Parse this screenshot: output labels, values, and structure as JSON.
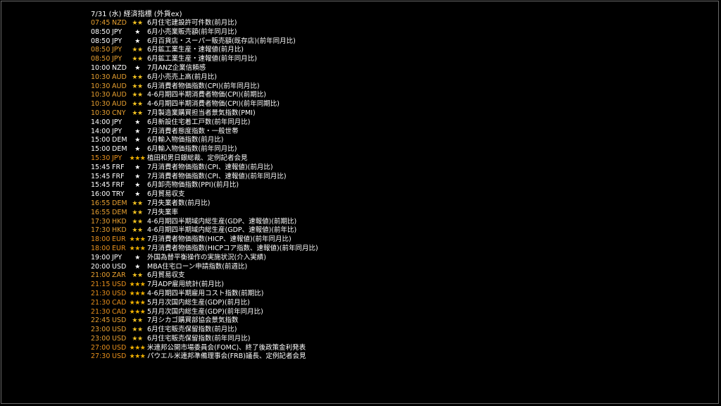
{
  "title": "7/31 (水) 経済指標 (外貨ex)",
  "colors": {
    "background": "#000000",
    "text": "#ffffff",
    "highlight_time": "#e8a030",
    "star": "#f0c020"
  },
  "events": [
    {
      "time": "07:45",
      "currency": "NZD",
      "stars": "★★",
      "name": "6月住宅建設許可件数(前月比)",
      "level": "hi"
    },
    {
      "time": "08:50",
      "currency": "JPY",
      "stars": "★",
      "name": "6月小売業販売額(前年同月比)",
      "level": "normal"
    },
    {
      "time": "08:50",
      "currency": "JPY",
      "stars": "★",
      "name": "6月百貨店・スーパー販売額(既存店)(前年同月比)",
      "level": "normal"
    },
    {
      "time": "08:50",
      "currency": "JPY",
      "stars": "★★",
      "name": "6月鉱工業生産・速報値(前月比)",
      "level": "hi"
    },
    {
      "time": "08:50",
      "currency": "JPY",
      "stars": "★★",
      "name": "6月鉱工業生産・速報値(前年同月比)",
      "level": "hi"
    },
    {
      "time": "10:00",
      "currency": "NZD",
      "stars": "★",
      "name": "7月ANZ企業信頼感",
      "level": "normal"
    },
    {
      "time": "10:30",
      "currency": "AUD",
      "stars": "★★",
      "name": "6月小売売上高(前月比)",
      "level": "hi"
    },
    {
      "time": "10:30",
      "currency": "AUD",
      "stars": "★★",
      "name": "6月消費者物価指数(CPI)(前年同月比)",
      "level": "hi"
    },
    {
      "time": "10:30",
      "currency": "AUD",
      "stars": "★★",
      "name": "4-6月期四半期消費者物価(CPI)(前期比)",
      "level": "hi"
    },
    {
      "time": "10:30",
      "currency": "AUD",
      "stars": "★★",
      "name": "4-6月期四半期消費者物価(CPI)(前年同期比)",
      "level": "hi"
    },
    {
      "time": "10:30",
      "currency": "CNY",
      "stars": "★★",
      "name": "7月製造業購買担当者景気指数(PMI)",
      "level": "hi"
    },
    {
      "time": "14:00",
      "currency": "JPY",
      "stars": "★",
      "name": "6月新設住宅着工戸数(前年同月比)",
      "level": "normal"
    },
    {
      "time": "14:00",
      "currency": "JPY",
      "stars": "★",
      "name": "7月消費者態度指数・一般世帯",
      "level": "normal"
    },
    {
      "time": "15:00",
      "currency": "DEM",
      "stars": "★",
      "name": "6月輸入物価指数(前月比)",
      "level": "normal"
    },
    {
      "time": "15:00",
      "currency": "DEM",
      "stars": "★",
      "name": "6月輸入物価指数(前年同月比)",
      "level": "normal"
    },
    {
      "time": "15:30",
      "currency": "JPY",
      "stars": "★★★",
      "name": "植田和男日銀総裁、定例記者会見",
      "level": "hi3"
    },
    {
      "time": "15:45",
      "currency": "FRF",
      "stars": "★",
      "name": "7月消費者物価指数(CPI、速報値)(前月比)",
      "level": "normal"
    },
    {
      "time": "15:45",
      "currency": "FRF",
      "stars": "★",
      "name": "7月消費者物価指数(CPI、速報値)(前年同月比)",
      "level": "normal"
    },
    {
      "time": "15:45",
      "currency": "FRF",
      "stars": "★",
      "name": "6月卸売物価指数(PPI)(前月比)",
      "level": "normal"
    },
    {
      "time": "16:00",
      "currency": "TRY",
      "stars": "★",
      "name": "6月貿易収支",
      "level": "normal"
    },
    {
      "time": "16:55",
      "currency": "DEM",
      "stars": "★★",
      "name": "7月失業者数(前月比)",
      "level": "hi"
    },
    {
      "time": "16:55",
      "currency": "DEM",
      "stars": "★★",
      "name": "7月失業率",
      "level": "hi"
    },
    {
      "time": "17:30",
      "currency": "HKD",
      "stars": "★★",
      "name": "4-6月期四半期域内総生産(GDP、速報値)(前期比)",
      "level": "hi"
    },
    {
      "time": "17:30",
      "currency": "HKD",
      "stars": "★★",
      "name": "4-6月期四半期域内総生産(GDP、速報値)(前年比)",
      "level": "hi"
    },
    {
      "time": "18:00",
      "currency": "EUR",
      "stars": "★★★",
      "name": "7月消費者物価指数(HICP、速報値)(前年同月比)",
      "level": "hi3"
    },
    {
      "time": "18:00",
      "currency": "EUR",
      "stars": "★★★",
      "name": "7月消費者物価指数(HICPコア指数、速報値)(前年同月比)",
      "level": "hi3"
    },
    {
      "time": "19:00",
      "currency": "JPY",
      "stars": "★",
      "name": "外国為替平衡操作の実施状況(介入実績)",
      "level": "normal"
    },
    {
      "time": "20:00",
      "currency": "USD",
      "stars": "★",
      "name": "MBA住宅ローン申請指数(前週比)",
      "level": "normal"
    },
    {
      "time": "21:00",
      "currency": "ZAR",
      "stars": "★★",
      "name": "6月貿易収支",
      "level": "hi"
    },
    {
      "time": "21:15",
      "currency": "USD",
      "stars": "★★★",
      "name": "7月ADP雇用統計(前月比)",
      "level": "hi3"
    },
    {
      "time": "21:30",
      "currency": "USD",
      "stars": "★★★",
      "name": "4-6月期四半期雇用コスト指数(前期比)",
      "level": "hi3"
    },
    {
      "time": "21:30",
      "currency": "CAD",
      "stars": "★★★",
      "name": "5月月次国内総生産(GDP)(前月比)",
      "level": "hi3"
    },
    {
      "time": "21:30",
      "currency": "CAD",
      "stars": "★★★",
      "name": "5月月次国内総生産(GDP)(前年同月比)",
      "level": "hi3"
    },
    {
      "time": "22:45",
      "currency": "USD",
      "stars": "★★",
      "name": "7月シカゴ購買部協会景気指数",
      "level": "hi"
    },
    {
      "time": "23:00",
      "currency": "USD",
      "stars": "★★",
      "name": "6月住宅販売保留指数(前月比)",
      "level": "hi"
    },
    {
      "time": "23:00",
      "currency": "USD",
      "stars": "★★",
      "name": "6月住宅販売保留指数(前年同月比)",
      "level": "hi"
    },
    {
      "time": "27:00",
      "currency": "USD",
      "stars": "★★★",
      "name": "米連邦公開市場委員会(FOMC)、終了後政策金利発表",
      "level": "hi3"
    },
    {
      "time": "27:30",
      "currency": "USD",
      "stars": "★★★",
      "name": "パウエル米連邦準備理事会(FRB)議長、定例記者会見",
      "level": "hi3"
    }
  ]
}
